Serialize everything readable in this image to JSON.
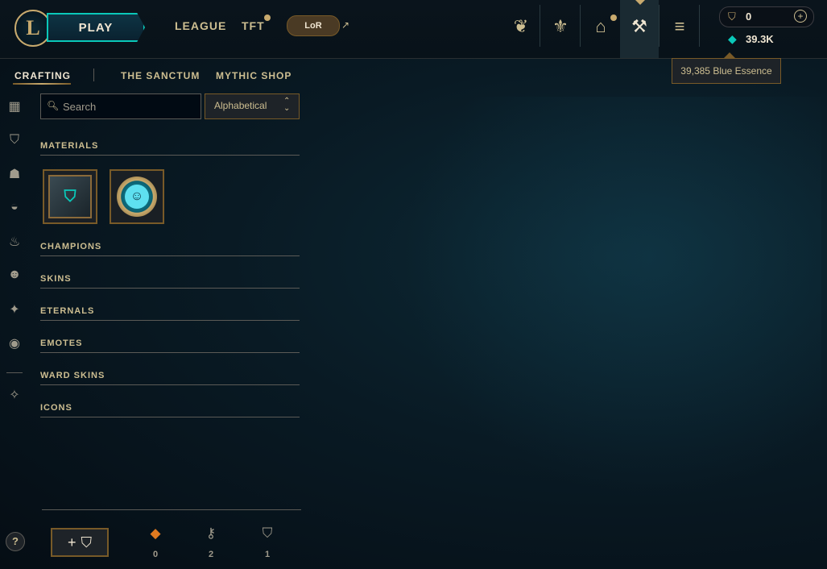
{
  "header": {
    "logo_letter": "L",
    "play_label": "PLAY",
    "nav": [
      {
        "label": "LEAGUE"
      },
      {
        "label": "TFT"
      },
      {
        "label": "LoR"
      }
    ],
    "icons": [
      "champions-icon",
      "collection-icon",
      "store-icon",
      "loot-icon",
      "currency-store-icon"
    ],
    "riot_points": "0",
    "blue_essence": "39.3K",
    "tooltip": "39,385 Blue Essence"
  },
  "subnav": {
    "tabs": [
      {
        "label": "CRAFTING"
      },
      {
        "label": "THE SANCTUM"
      },
      {
        "label": "MYTHIC SHOP"
      }
    ]
  },
  "rail": {
    "icons": [
      "grid-icon",
      "chest-icon",
      "champion-helmet-icon",
      "mask-icon",
      "eternal-flame-icon",
      "emote-icon",
      "ward-icon",
      "profile-icon",
      "misc-icon"
    ],
    "help": "?"
  },
  "search": {
    "placeholder": "Search"
  },
  "sort": {
    "selected": "Alphabetical"
  },
  "sections": [
    {
      "title": "MATERIALS"
    },
    {
      "title": "CHAMPIONS"
    },
    {
      "title": "SKINS"
    },
    {
      "title": "ETERNALS"
    },
    {
      "title": "EMOTES"
    },
    {
      "title": "WARD SKINS"
    },
    {
      "title": "ICONS"
    }
  ],
  "bottom": {
    "add_symbol": "+",
    "counts": [
      {
        "icon": "orange-essence-icon",
        "value": "0",
        "color": "#e07a20"
      },
      {
        "icon": "key-icon",
        "value": "2",
        "color": "#a09b8c"
      },
      {
        "icon": "chest-icon",
        "value": "1",
        "color": "#a09b8c"
      }
    ]
  }
}
